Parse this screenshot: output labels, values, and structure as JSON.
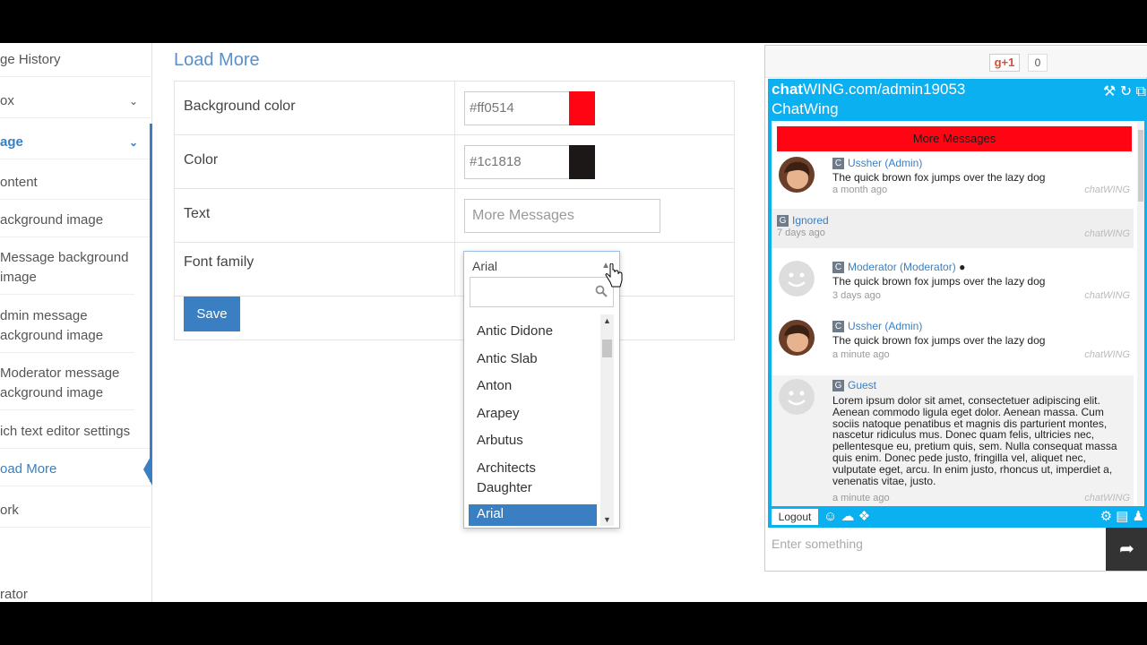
{
  "sidebar": {
    "items": [
      {
        "label": "ge History"
      },
      {
        "label": "ox"
      },
      {
        "label": "age"
      },
      {
        "label": "ontent"
      },
      {
        "label": "ackground image"
      },
      {
        "label": "Message background image"
      },
      {
        "label": "dmin message ackground image"
      },
      {
        "label": "Moderator message ackground image"
      },
      {
        "label": "ich text editor settings"
      },
      {
        "label": "oad More"
      },
      {
        "label": "ork"
      },
      {
        "label": "rator"
      }
    ]
  },
  "form": {
    "title": "Load More",
    "rows": {
      "background_color": {
        "label": "Background color",
        "value": "#ff0514",
        "swatch": "#ff0514"
      },
      "color": {
        "label": "Color",
        "value": "#1c1818",
        "swatch": "#1c1818"
      },
      "text": {
        "label": "Text",
        "placeholder": "More Messages"
      },
      "font_family": {
        "label": "Font family"
      }
    },
    "save_label": "Save"
  },
  "font_dropdown": {
    "selected": "Arial",
    "search_value": "",
    "options": [
      "Antic Didone",
      "Antic Slab",
      "Anton",
      "Arapey",
      "Arbutus",
      "Architects Daughter",
      "Arial"
    ]
  },
  "chat": {
    "gplus_label": "g+1",
    "gplus_count": "0",
    "url_prefix": "chat",
    "url_rest": "WING.com/admin19053",
    "name": "ChatWing",
    "load_more_label": "More Messages",
    "load_more_bg": "#ff0514",
    "load_more_color": "#1c1818",
    "brand": "chatWING",
    "messages": [
      {
        "badge": "C",
        "name": "Ussher (Admin)",
        "text": "The quick brown fox jumps over the lazy dog",
        "time": "a month ago"
      },
      {
        "badge": "G",
        "name": "Ignored",
        "text": "",
        "time": "7 days ago"
      },
      {
        "badge": "C",
        "name": "Moderator (Moderator)",
        "text": "The quick brown fox jumps over the lazy dog",
        "time": "3 days ago"
      },
      {
        "badge": "C",
        "name": "Ussher (Admin)",
        "text": "The quick brown fox jumps over the lazy dog",
        "time": "a minute ago"
      },
      {
        "badge": "G",
        "name": "Guest",
        "text": "Lorem ipsum dolor sit amet, consectetuer adipiscing elit. Aenean commodo ligula eget dolor. Aenean massa. Cum sociis natoque penatibus et magnis dis parturient montes, nascetur ridiculus mus. Donec quam felis, ultricies nec, pellentesque eu, pretium quis, sem. Nulla consequat massa quis enim. Donec pede justo, fringilla vel, aliquet nec, vulputate eget, arcu. In enim justo, rhoncus ut, imperdiet a, venenatis vitae, justo.",
        "time": "a minute ago"
      }
    ],
    "logout_label": "Logout",
    "input_placeholder": "Enter something",
    "accent": "#0ab0f0"
  }
}
